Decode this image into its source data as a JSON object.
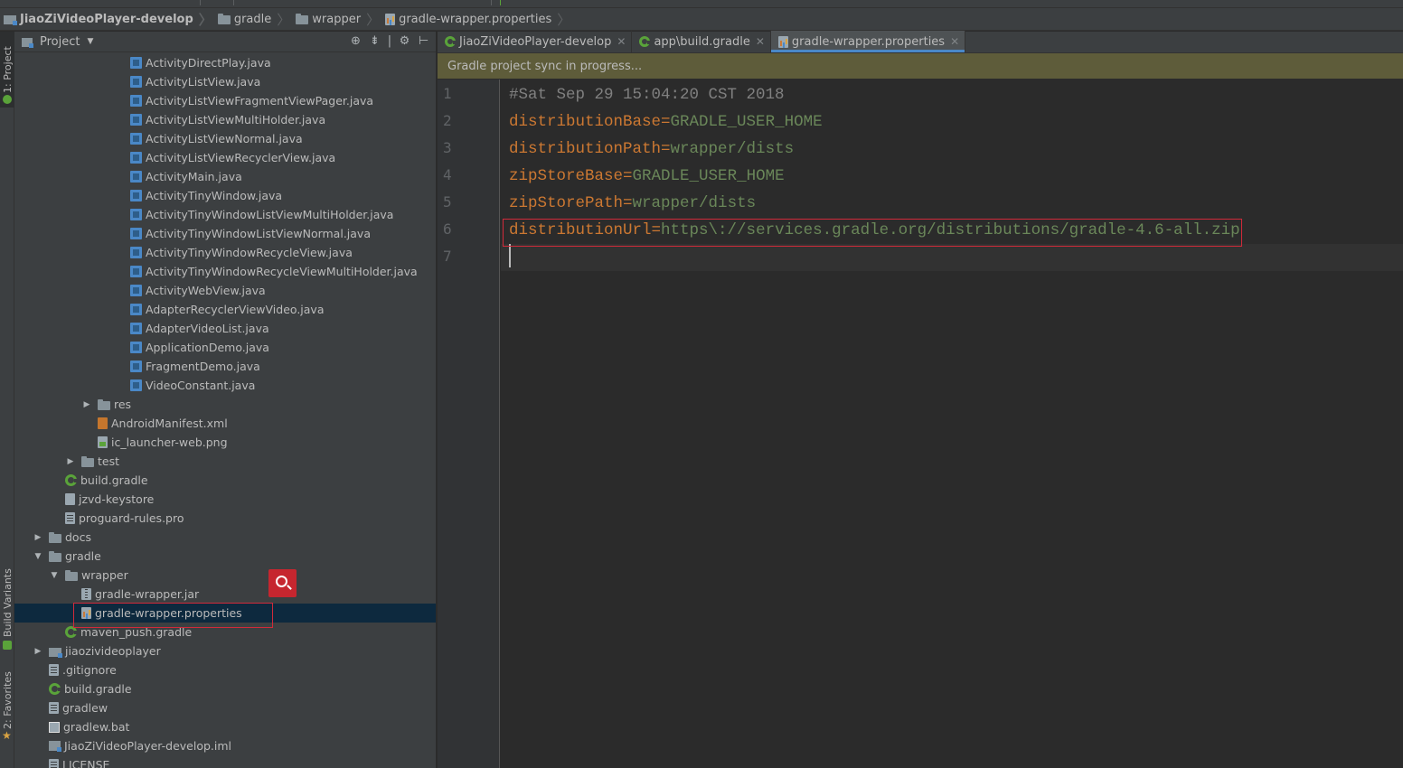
{
  "breadcrumb": {
    "items": [
      "JiaoZiVideoPlayer-develop",
      "gradle",
      "wrapper",
      "gradle-wrapper.properties"
    ]
  },
  "left_strip": {
    "project_tab": "1: Project",
    "build_variants_tab": "Build Variants",
    "favorites_tab": "2: Favorites"
  },
  "project_panel": {
    "title": "Project",
    "tree": [
      {
        "label": "ActivityDirectPlay.java",
        "kind": "java"
      },
      {
        "label": "ActivityListView.java",
        "kind": "java"
      },
      {
        "label": "ActivityListViewFragmentViewPager.java",
        "kind": "java"
      },
      {
        "label": "ActivityListViewMultiHolder.java",
        "kind": "java"
      },
      {
        "label": "ActivityListViewNormal.java",
        "kind": "java"
      },
      {
        "label": "ActivityListViewRecyclerView.java",
        "kind": "java"
      },
      {
        "label": "ActivityMain.java",
        "kind": "java"
      },
      {
        "label": "ActivityTinyWindow.java",
        "kind": "java"
      },
      {
        "label": "ActivityTinyWindowListViewMultiHolder.java",
        "kind": "java"
      },
      {
        "label": "ActivityTinyWindowListViewNormal.java",
        "kind": "java"
      },
      {
        "label": "ActivityTinyWindowRecycleView.java",
        "kind": "java"
      },
      {
        "label": "ActivityTinyWindowRecycleViewMultiHolder.java",
        "kind": "java"
      },
      {
        "label": "ActivityWebView.java",
        "kind": "java"
      },
      {
        "label": "AdapterRecyclerViewVideo.java",
        "kind": "java"
      },
      {
        "label": "AdapterVideoList.java",
        "kind": "java"
      },
      {
        "label": "ApplicationDemo.java",
        "kind": "java"
      },
      {
        "label": "FragmentDemo.java",
        "kind": "java"
      },
      {
        "label": "VideoConstant.java",
        "kind": "java"
      },
      {
        "label": "res",
        "kind": "folder"
      },
      {
        "label": "AndroidManifest.xml",
        "kind": "xml"
      },
      {
        "label": "ic_launcher-web.png",
        "kind": "png"
      },
      {
        "label": "test",
        "kind": "folder"
      },
      {
        "label": "build.gradle",
        "kind": "gradle"
      },
      {
        "label": "jzvd-keystore",
        "kind": "key"
      },
      {
        "label": "proguard-rules.pro",
        "kind": "generic"
      },
      {
        "label": "docs",
        "kind": "folder"
      },
      {
        "label": "gradle",
        "kind": "folder"
      },
      {
        "label": "wrapper",
        "kind": "folder"
      },
      {
        "label": "gradle-wrapper.jar",
        "kind": "jar"
      },
      {
        "label": "gradle-wrapper.properties",
        "kind": "properties"
      },
      {
        "label": "maven_push.gradle",
        "kind": "gradle"
      },
      {
        "label": "jiaozivideoplayer",
        "kind": "module"
      },
      {
        "label": ".gitignore",
        "kind": "generic"
      },
      {
        "label": "build.gradle",
        "kind": "gradle"
      },
      {
        "label": "gradlew",
        "kind": "generic"
      },
      {
        "label": "gradlew.bat",
        "kind": "bat"
      },
      {
        "label": "JiaoZiVideoPlayer-develop.iml",
        "kind": "iml"
      },
      {
        "label": "LICENSE",
        "kind": "generic"
      }
    ]
  },
  "editor": {
    "tabs": [
      {
        "label": "JiaoZiVideoPlayer-develop"
      },
      {
        "label": "app\\build.gradle"
      },
      {
        "label": "gradle-wrapper.properties"
      }
    ],
    "banner": "Gradle project sync in progress...",
    "line_numbers": [
      "1",
      "2",
      "3",
      "4",
      "5",
      "6",
      "7"
    ],
    "lines": [
      {
        "comment": "#Sat Sep 29 15:04:20 CST 2018"
      },
      {
        "key": "distributionBase",
        "eq": "=",
        "value": "GRADLE_USER_HOME"
      },
      {
        "key": "distributionPath",
        "eq": "=",
        "value": "wrapper/dists"
      },
      {
        "key": "zipStoreBase",
        "eq": "=",
        "value": "GRADLE_USER_HOME"
      },
      {
        "key": "zipStorePath",
        "eq": "=",
        "value": "wrapper/dists"
      },
      {
        "key": "distributionUrl",
        "eq": "=",
        "value": "https\\://services.gradle.org/distributions/gradle-4.6-all.zip"
      }
    ]
  },
  "colors": {
    "highlight_box": "#d12a3a",
    "search_badge": "#c6262f",
    "banner_bg": "#5e5c3a",
    "selection_bg": "#0d293e",
    "key_color": "#cc7832",
    "value_color": "#6a8759"
  },
  "icons": {
    "search_badge": "magnifier-icon",
    "project_header": [
      "locate-icon",
      "collapse-icon",
      "gear-icon",
      "hide-icon"
    ]
  }
}
